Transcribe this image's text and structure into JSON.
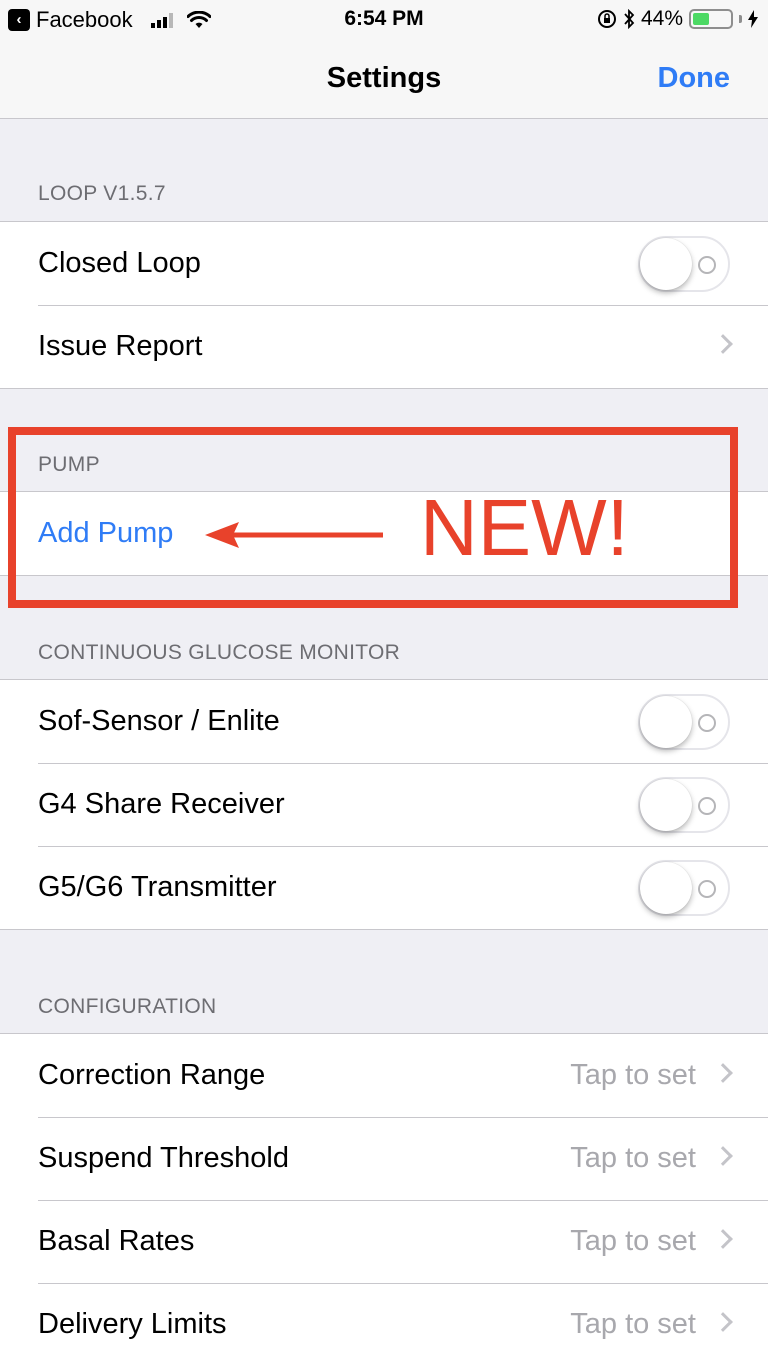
{
  "status_bar": {
    "back_app": "Facebook",
    "time": "6:54 PM",
    "battery_percent": "44%",
    "battery_level": 0.44
  },
  "nav": {
    "title": "Settings",
    "done_label": "Done"
  },
  "sections": {
    "loop": {
      "header": "LOOP V1.5.7",
      "closed_loop": {
        "label": "Closed Loop",
        "on": false
      },
      "issue_report": {
        "label": "Issue Report"
      }
    },
    "pump": {
      "header": "PUMP",
      "add_pump": {
        "label": "Add Pump"
      }
    },
    "cgm": {
      "header": "CONTINUOUS GLUCOSE MONITOR",
      "sof_sensor": {
        "label": "Sof-Sensor / Enlite",
        "on": false
      },
      "g4_share": {
        "label": "G4 Share Receiver",
        "on": false
      },
      "g5_g6": {
        "label": "G5/G6 Transmitter",
        "on": false
      }
    },
    "configuration": {
      "header": "CONFIGURATION",
      "correction_range": {
        "label": "Correction Range",
        "value": "Tap to set"
      },
      "suspend_threshold": {
        "label": "Suspend Threshold",
        "value": "Tap to set"
      },
      "basal_rates": {
        "label": "Basal Rates",
        "value": "Tap to set"
      },
      "delivery_limits": {
        "label": "Delivery Limits",
        "value": "Tap to set"
      }
    }
  },
  "annotation": {
    "text": "NEW!",
    "color": "#e8422b"
  },
  "colors": {
    "accent": "#2f7cf6",
    "background": "#efeff4",
    "battery_green": "#4cd964"
  }
}
